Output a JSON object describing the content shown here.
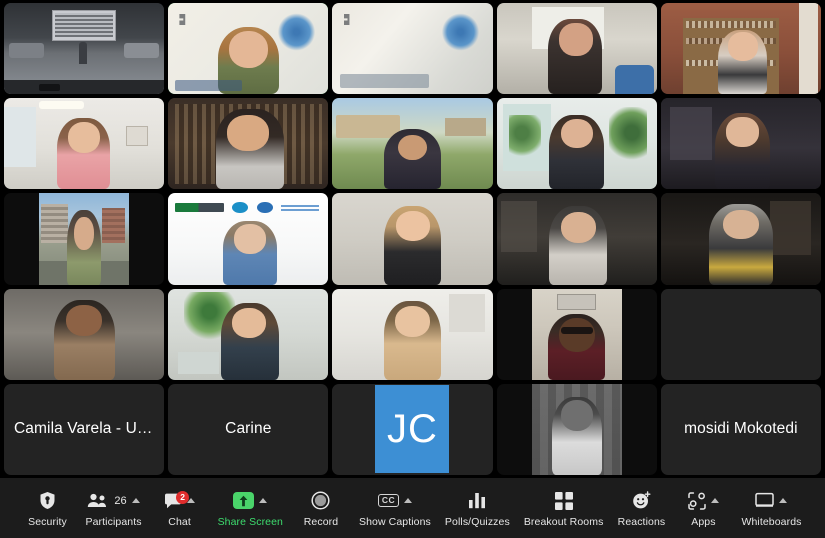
{
  "meeting": {
    "layout": "gallery-view",
    "accent_active_speaker_color": "#35c759",
    "avatar_color": "#3d8fd4",
    "share_screen_color": "#4ad46a",
    "toolbar_bg": "#1c1c1c"
  },
  "tiles": [
    {
      "id": 1,
      "kind": "video",
      "name": "",
      "scene": "lecture-hall",
      "active": false
    },
    {
      "id": 2,
      "kind": "video",
      "name": "",
      "scene": "virtual-bg-globe-person",
      "active": true
    },
    {
      "id": 3,
      "kind": "video",
      "name": "",
      "scene": "virtual-bg-globe-empty",
      "active": false
    },
    {
      "id": 4,
      "kind": "video",
      "name": "",
      "scene": "office-window",
      "active": false
    },
    {
      "id": 5,
      "kind": "video",
      "name": "",
      "scene": "bookshelf-warm",
      "active": false
    },
    {
      "id": 6,
      "kind": "video",
      "name": "",
      "scene": "bright-room",
      "active": false
    },
    {
      "id": 7,
      "kind": "video",
      "name": "",
      "scene": "dark-bookshelf",
      "active": false
    },
    {
      "id": 8,
      "kind": "video",
      "name": "",
      "scene": "outdoor-garden",
      "active": false
    },
    {
      "id": 9,
      "kind": "video",
      "name": "",
      "scene": "plants-window",
      "active": false
    },
    {
      "id": 10,
      "kind": "video",
      "name": "",
      "scene": "dark-interior",
      "active": false
    },
    {
      "id": 11,
      "kind": "video",
      "name": "",
      "scene": "city-street-bg",
      "active": false,
      "pillar": true
    },
    {
      "id": 12,
      "kind": "video",
      "name": "",
      "scene": "uab-nursing-banner",
      "active": false
    },
    {
      "id": 13,
      "kind": "video",
      "name": "",
      "scene": "light-wall",
      "active": false
    },
    {
      "id": 14,
      "kind": "video",
      "name": "",
      "scene": "dark-room-person",
      "active": false
    },
    {
      "id": 15,
      "kind": "video",
      "name": "",
      "scene": "dim-study",
      "active": false
    },
    {
      "id": 16,
      "kind": "video",
      "name": "",
      "scene": "neutral-wall",
      "active": false
    },
    {
      "id": 17,
      "kind": "video",
      "name": "",
      "scene": "home-office-plant",
      "active": false
    },
    {
      "id": 18,
      "kind": "video",
      "name": "",
      "scene": "white-room",
      "active": false
    },
    {
      "id": 19,
      "kind": "video",
      "name": "",
      "scene": "portrait-dark-glasses",
      "active": false,
      "pillar": true
    },
    {
      "id": 20,
      "kind": "empty",
      "name": "",
      "scene": "",
      "active": false
    },
    {
      "id": 21,
      "kind": "name",
      "name": "Camila Varela - UC...",
      "scene": "",
      "active": false
    },
    {
      "id": 22,
      "kind": "name",
      "name": "Carine",
      "scene": "",
      "active": false
    },
    {
      "id": 23,
      "kind": "avatar",
      "name": "",
      "initials": "JC",
      "scene": "",
      "active": false
    },
    {
      "id": 24,
      "kind": "video",
      "name": "",
      "scene": "bw-portrait-door",
      "active": false,
      "pillar": true
    },
    {
      "id": 25,
      "kind": "name",
      "name": "mosidi Mokotedi",
      "scene": "",
      "active": false
    }
  ],
  "toolbar": {
    "items": [
      {
        "key": "security",
        "label": "Security",
        "icon": "shield-icon",
        "caret": false,
        "accent": false
      },
      {
        "key": "participants",
        "label": "Participants",
        "icon": "participants-icon",
        "caret": true,
        "accent": false,
        "count": "26"
      },
      {
        "key": "chat",
        "label": "Chat",
        "icon": "chat-bubble-icon",
        "caret": true,
        "accent": false,
        "badge": "2"
      },
      {
        "key": "share",
        "label": "Share Screen",
        "icon": "share-screen-icon",
        "caret": true,
        "accent": true
      },
      {
        "key": "record",
        "label": "Record",
        "icon": "record-circle-icon",
        "caret": false,
        "accent": false
      },
      {
        "key": "captions",
        "label": "Show Captions",
        "icon": "closed-caption-icon",
        "caret": true,
        "accent": false,
        "cc": "CC"
      },
      {
        "key": "polls",
        "label": "Polls/Quizzes",
        "icon": "bar-chart-icon",
        "caret": false,
        "accent": false
      },
      {
        "key": "breakout",
        "label": "Breakout Rooms",
        "icon": "grid-squares-icon",
        "caret": false,
        "accent": false
      },
      {
        "key": "reactions",
        "label": "Reactions",
        "icon": "smiley-reaction-icon",
        "caret": false,
        "accent": false
      },
      {
        "key": "apps",
        "label": "Apps",
        "icon": "apps-icon",
        "caret": true,
        "accent": false
      },
      {
        "key": "whiteboards",
        "label": "Whiteboards",
        "icon": "whiteboard-icon",
        "caret": true,
        "accent": false
      }
    ]
  }
}
